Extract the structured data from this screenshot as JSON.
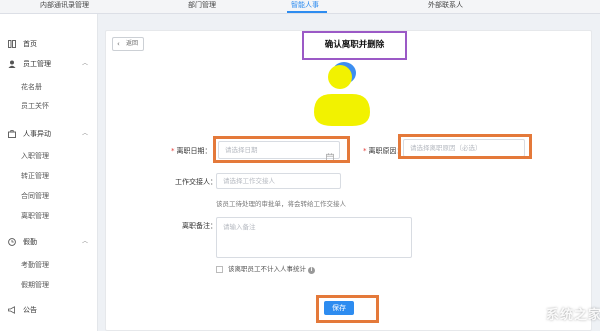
{
  "topnav": {
    "tabs": [
      {
        "label": "内部通讯录管理"
      },
      {
        "label": "部门管理"
      },
      {
        "label": "智能人事"
      },
      {
        "label": "外部联系人"
      }
    ],
    "active": "智能人事"
  },
  "sidebar": {
    "items": [
      {
        "label": "首页",
        "icon": "home-icon"
      },
      {
        "label": "员工管理",
        "icon": "user-icon",
        "expanded": true
      },
      {
        "label": "花名册"
      },
      {
        "label": "员工关怀"
      },
      {
        "label": "人事异动",
        "icon": "briefcase-icon",
        "expanded": true
      },
      {
        "label": "入职管理"
      },
      {
        "label": "转正管理"
      },
      {
        "label": "合同管理"
      },
      {
        "label": "离职管理"
      },
      {
        "label": "假勤",
        "icon": "clock-icon",
        "expanded": true
      },
      {
        "label": "考勤管理"
      },
      {
        "label": "假期管理"
      },
      {
        "label": "公告",
        "icon": "megaphone-icon"
      }
    ]
  },
  "page": {
    "back_label": "返回",
    "title": "确认离职并删除"
  },
  "form": {
    "leave_date": {
      "label": "离职日期：",
      "placeholder": "请选择日期"
    },
    "leave_reason": {
      "label": "离职原因：",
      "placeholder": "请选择离职原因（必选）"
    },
    "handover": {
      "label": "工作交接人：",
      "placeholder": "请选择工作交接人"
    },
    "handover_hint": "该员工待处理的审批单，将会转给工作交接人",
    "remark": {
      "label": "离职备注：",
      "placeholder": "请输入备注"
    },
    "exclude_checkbox": {
      "label": "该离职员工不计入人事统计",
      "checked": false
    }
  },
  "actions": {
    "save_label": "保存"
  },
  "watermark": {
    "text": "系统之家"
  },
  "colors": {
    "accent": "#2d8cf0",
    "highlight_orange": "#e4793a",
    "highlight_purple": "#9b59c6",
    "avatar_yellow": "#f2f200",
    "avatar_blue": "#3d8ef0"
  }
}
